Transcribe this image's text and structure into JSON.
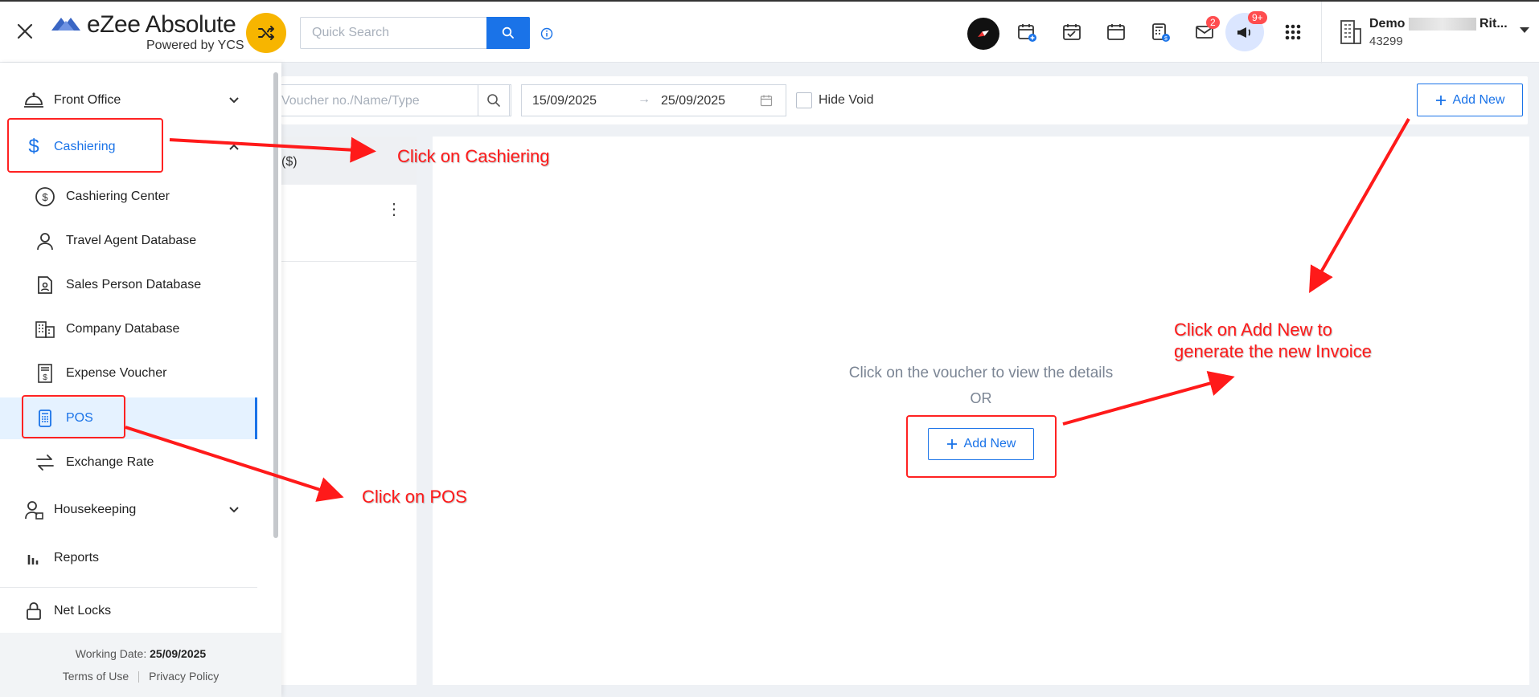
{
  "header": {
    "logo_title": "eZee Absolute",
    "logo_subtitle": "Powered by YCS",
    "search_placeholder": "Quick Search",
    "notification_mail_count": "2",
    "announcement_count": "9+",
    "user_name_start": "Demo",
    "user_name_end": "Rit...",
    "user_id": "43299"
  },
  "filters": {
    "voucher_placeholder": "Voucher no./Name/Type",
    "date_from": "15/09/2025",
    "date_arrow": "→",
    "date_to": "25/09/2025",
    "hide_void_label": "Hide Void",
    "add_new_label": "Add New"
  },
  "list_panel": {
    "column_header": "($)"
  },
  "detail_panel": {
    "empty_message": "Click on the voucher to view the details",
    "or_text": "OR",
    "add_new_label": "Add New"
  },
  "sidebar": {
    "front_office": "Front Office",
    "cashiering": "Cashiering",
    "sub_items": [
      {
        "label": "Cashiering Center",
        "icon": "dollar-circle-icon"
      },
      {
        "label": "Travel Agent Database",
        "icon": "person-icon"
      },
      {
        "label": "Sales Person Database",
        "icon": "badge-icon"
      },
      {
        "label": "Company Database",
        "icon": "building-icon"
      },
      {
        "label": "Expense Voucher",
        "icon": "receipt-icon"
      },
      {
        "label": "POS",
        "icon": "pos-icon"
      },
      {
        "label": "Exchange Rate",
        "icon": "exchange-icon"
      }
    ],
    "housekeeping": "Housekeeping",
    "reports": "Reports",
    "net_locks": "Net Locks",
    "working_date_label": "Working Date:",
    "working_date_value": "25/09/2025",
    "terms_label": "Terms of Use",
    "privacy_label": "Privacy Policy"
  },
  "annotations": {
    "cashiering_note": "Click on Cashiering",
    "pos_note": "Click on POS",
    "add_new_note_line1": "Click on Add New to",
    "add_new_note_line2": "generate the new Invoice"
  },
  "colors": {
    "accent": "#1a73e8",
    "annotation": "#ff1a1a",
    "switch_button": "#f7b500",
    "badge": "#ff4d4f"
  }
}
